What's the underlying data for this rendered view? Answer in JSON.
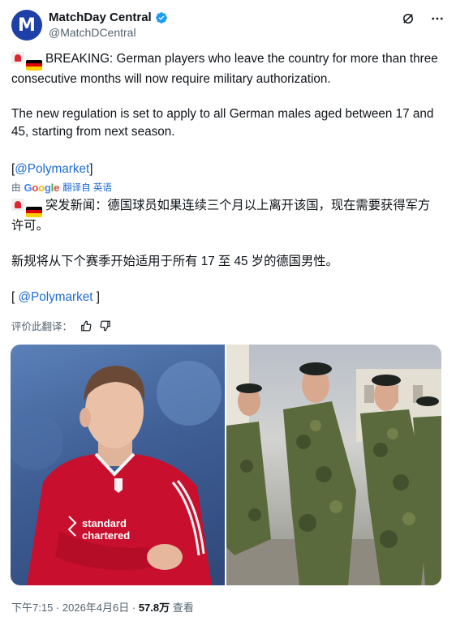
{
  "account": {
    "avatar_letter": "M",
    "display_name": "MatchDay Central",
    "handle": "@MatchDCentral",
    "verified": true
  },
  "header_icons": [
    "grok-icon",
    "more-icon"
  ],
  "tweet": {
    "line1": "BREAKING: German players who leave the country for more than three consecutive months will now require military authorization.",
    "para2": "The new regulation is set to apply to all German males aged between 17 and 45, starting from next season.",
    "tag": "@Polymarket",
    "tag_open": "[",
    "tag_close": "]"
  },
  "translation": {
    "by": "由",
    "provider": "Google",
    "action": "翻译自 英语",
    "line1": "突发新闻：德国球员如果连续三个月以上离开该国，现在需要获得军方许可。",
    "para2": "新规将从下个赛季开始适用于所有 17 至 45 岁的德国男性。",
    "tag_open": "[ ",
    "tag": "@Polymarket",
    "tag_close": " ]"
  },
  "rate_label": "评价此翻译：",
  "footer": {
    "time": "下午7:15",
    "sep1": " · ",
    "date": "2026年4月6日",
    "sep2": " · ",
    "views": "57.8万",
    "views_label": " 查看"
  },
  "colors": {
    "link": "#1d6bd6",
    "avatar": "#1d3fa8",
    "verified": "#1d9bf0",
    "muted": "#536471"
  }
}
